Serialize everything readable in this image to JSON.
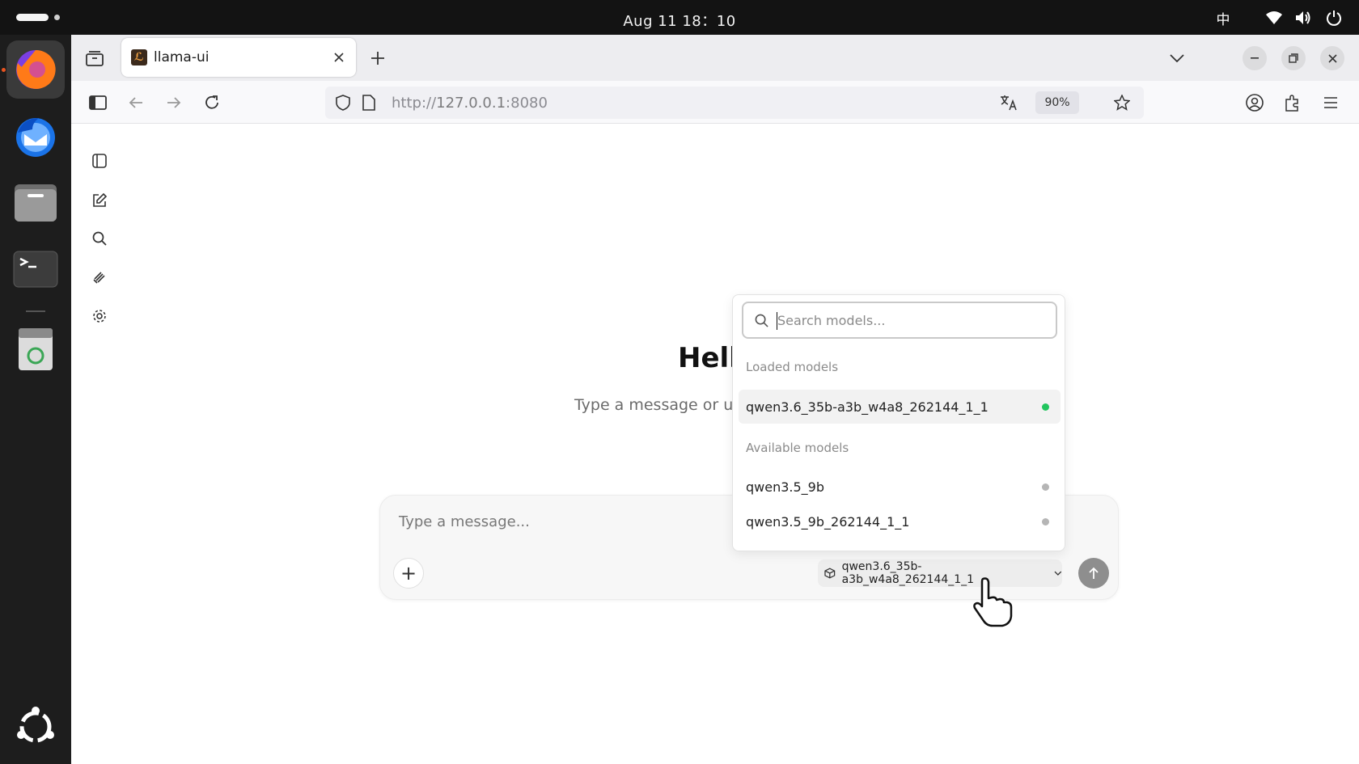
{
  "system": {
    "clock": "Aug 11  18：10",
    "input_method": "中"
  },
  "browser": {
    "tab_title": "llama-ui",
    "url_scheme": "http://",
    "url_host": "127.0.0.1",
    "url_port": ":8080",
    "zoom": "90%"
  },
  "page": {
    "greeting": "Hell",
    "subtitle": "Type a message or u",
    "composer": {
      "placeholder": "Type a message...",
      "add_label": "+",
      "selected_model": "qwen3.6_35b-a3b_w4a8_262144_1_1"
    },
    "model_menu": {
      "search_placeholder": "Search models...",
      "loaded_label": "Loaded models",
      "available_label": "Available models",
      "loaded_models": [
        {
          "name": "qwen3.6_35b-a3b_w4a8_262144_1_1",
          "status_color": "#22c55e"
        }
      ],
      "available_models": [
        {
          "name": "qwen3.5_9b",
          "status_color": "#b5b5b5"
        },
        {
          "name": "qwen3.5_9b_262144_1_1",
          "status_color": "#b5b5b5"
        }
      ]
    }
  },
  "icons": {
    "sidebar": [
      "sidebar-toggle-icon",
      "new-chat-icon",
      "search-icon",
      "attachment-icon",
      "settings-icon"
    ],
    "dock": [
      "firefox-icon",
      "thunderbird-icon",
      "files-icon",
      "terminal-icon",
      "trash-icon",
      "ubuntu-logo-icon"
    ]
  }
}
